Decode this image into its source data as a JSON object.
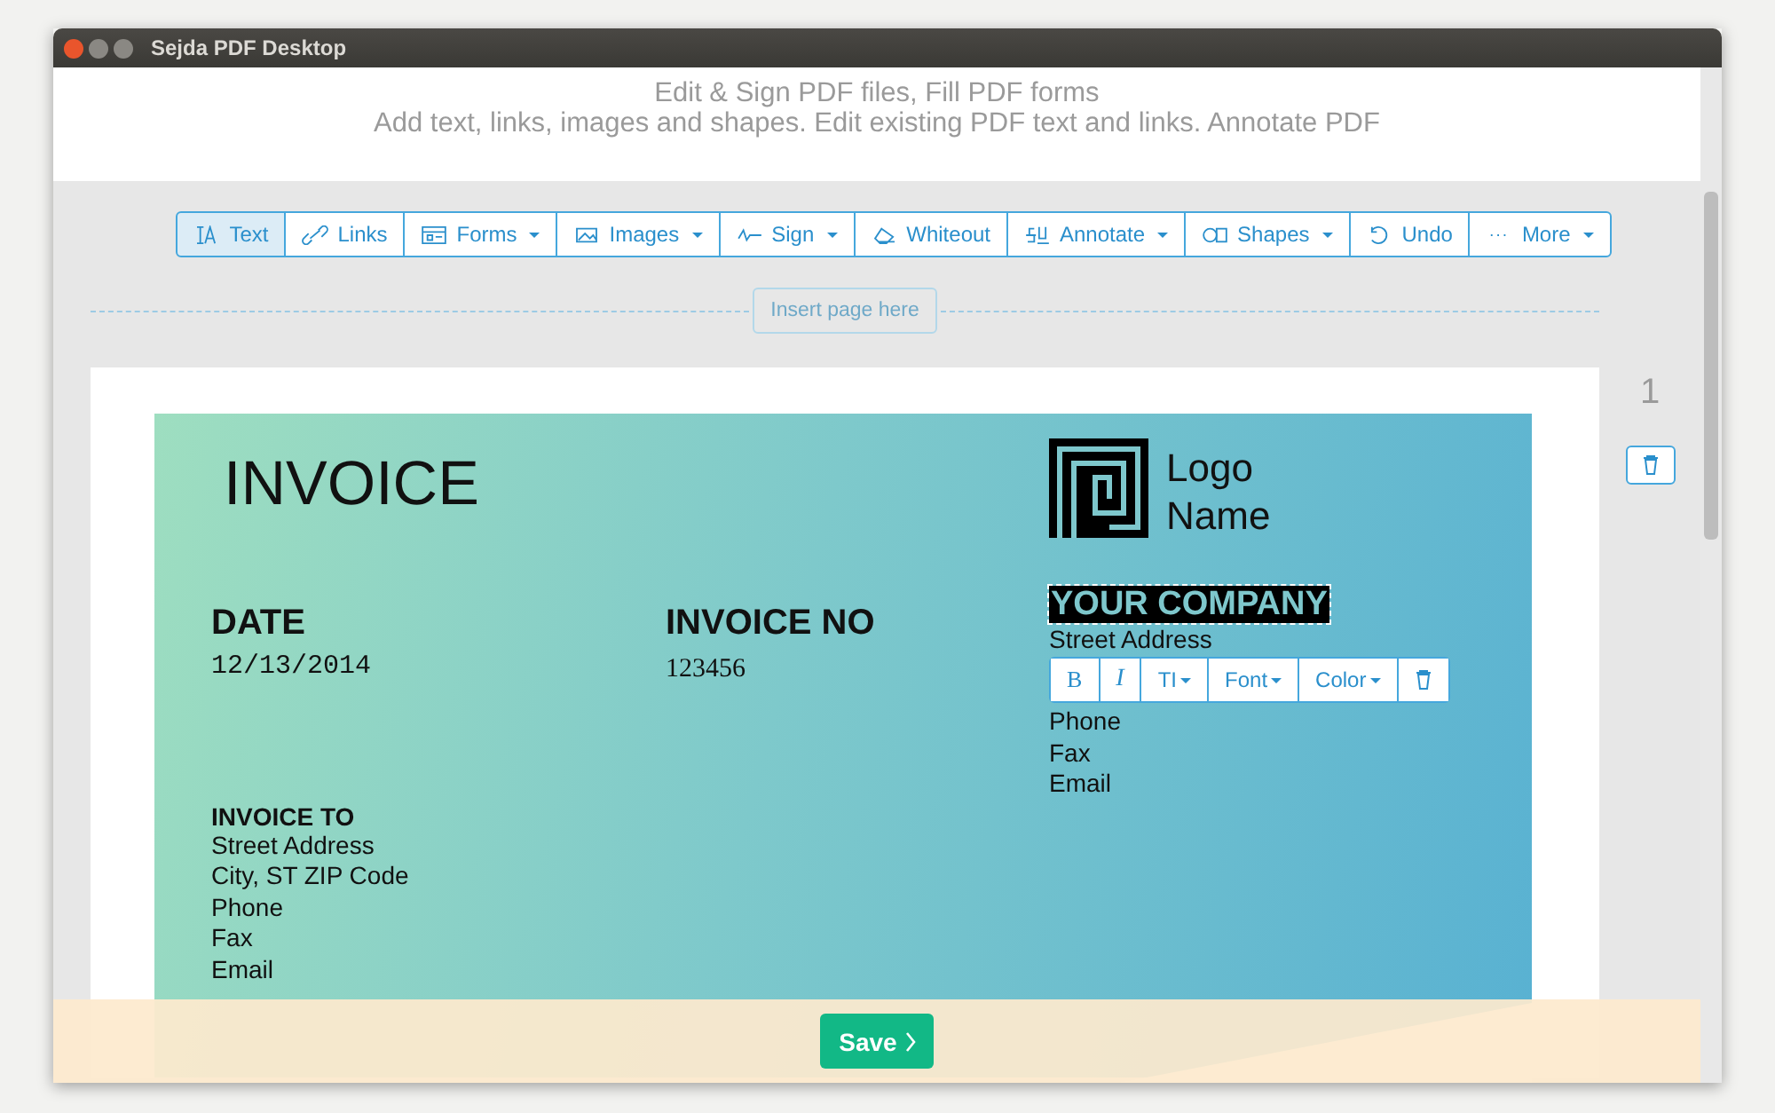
{
  "window": {
    "title": "Sejda PDF Desktop"
  },
  "header": {
    "line_1": "Edit & Sign PDF files, Fill PDF forms",
    "line_2": "Add text, links, images and shapes. Edit existing PDF text and links. Annotate PDF"
  },
  "toolbar": [
    {
      "label": "Text",
      "selected": true,
      "dropdown": false
    },
    {
      "label": "Links",
      "selected": false,
      "dropdown": false
    },
    {
      "label": "Forms",
      "selected": false,
      "dropdown": true
    },
    {
      "label": "Images",
      "selected": false,
      "dropdown": true
    },
    {
      "label": "Sign",
      "selected": false,
      "dropdown": true
    },
    {
      "label": "Whiteout",
      "selected": false,
      "dropdown": false
    },
    {
      "label": "Annotate",
      "selected": false,
      "dropdown": true
    },
    {
      "label": "Shapes",
      "selected": false,
      "dropdown": true
    },
    {
      "label": "Undo",
      "selected": false,
      "dropdown": false
    },
    {
      "label": "More",
      "selected": false,
      "dropdown": true
    }
  ],
  "insert_page": "Insert page here",
  "page_number": "1",
  "invoice": {
    "title": "INVOICE",
    "logo_line_1": "Logo",
    "logo_line_2": "Name",
    "date_label": "DATE",
    "date": "12/13/2014",
    "number_label": "INVOICE NO",
    "number": "123456",
    "company": "YOUR COMPANY",
    "company_lines": [
      "Street Address",
      "Phone",
      "Fax",
      "Email"
    ],
    "to_label": "INVOICE TO",
    "to_lines": [
      "Street Address",
      "City, ST ZIP Code",
      "Phone",
      "Fax",
      "Email"
    ]
  },
  "text_toolbar": [
    {
      "label": "B",
      "dropdown": false
    },
    {
      "label": "I",
      "dropdown": false
    },
    {
      "label": "TI",
      "dropdown": true
    },
    {
      "label": "Font",
      "dropdown": true
    },
    {
      "label": "Color",
      "dropdown": true
    }
  ],
  "save_button": "Save"
}
